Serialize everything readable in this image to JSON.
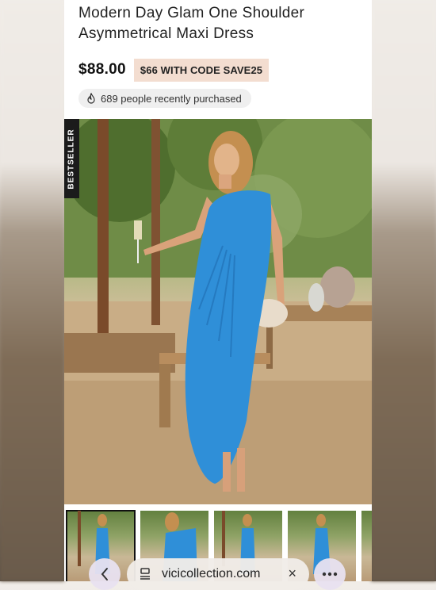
{
  "product": {
    "title_line1": "Modern Day Glam One Shoulder",
    "title_line2": "Asymmetrical Maxi Dress",
    "price": "$88.00",
    "promo": "$66 WITH CODE SAVE25",
    "social_proof": "689 people recently purchased"
  },
  "hero": {
    "badge": "BESTSELLER",
    "dress_color": "#2f8fd8"
  },
  "browser": {
    "url": "vicicollection.com",
    "close_label": "×"
  },
  "colors": {
    "promo_bg": "#f3ddd0",
    "badge_bg": "#1b1b1b"
  }
}
